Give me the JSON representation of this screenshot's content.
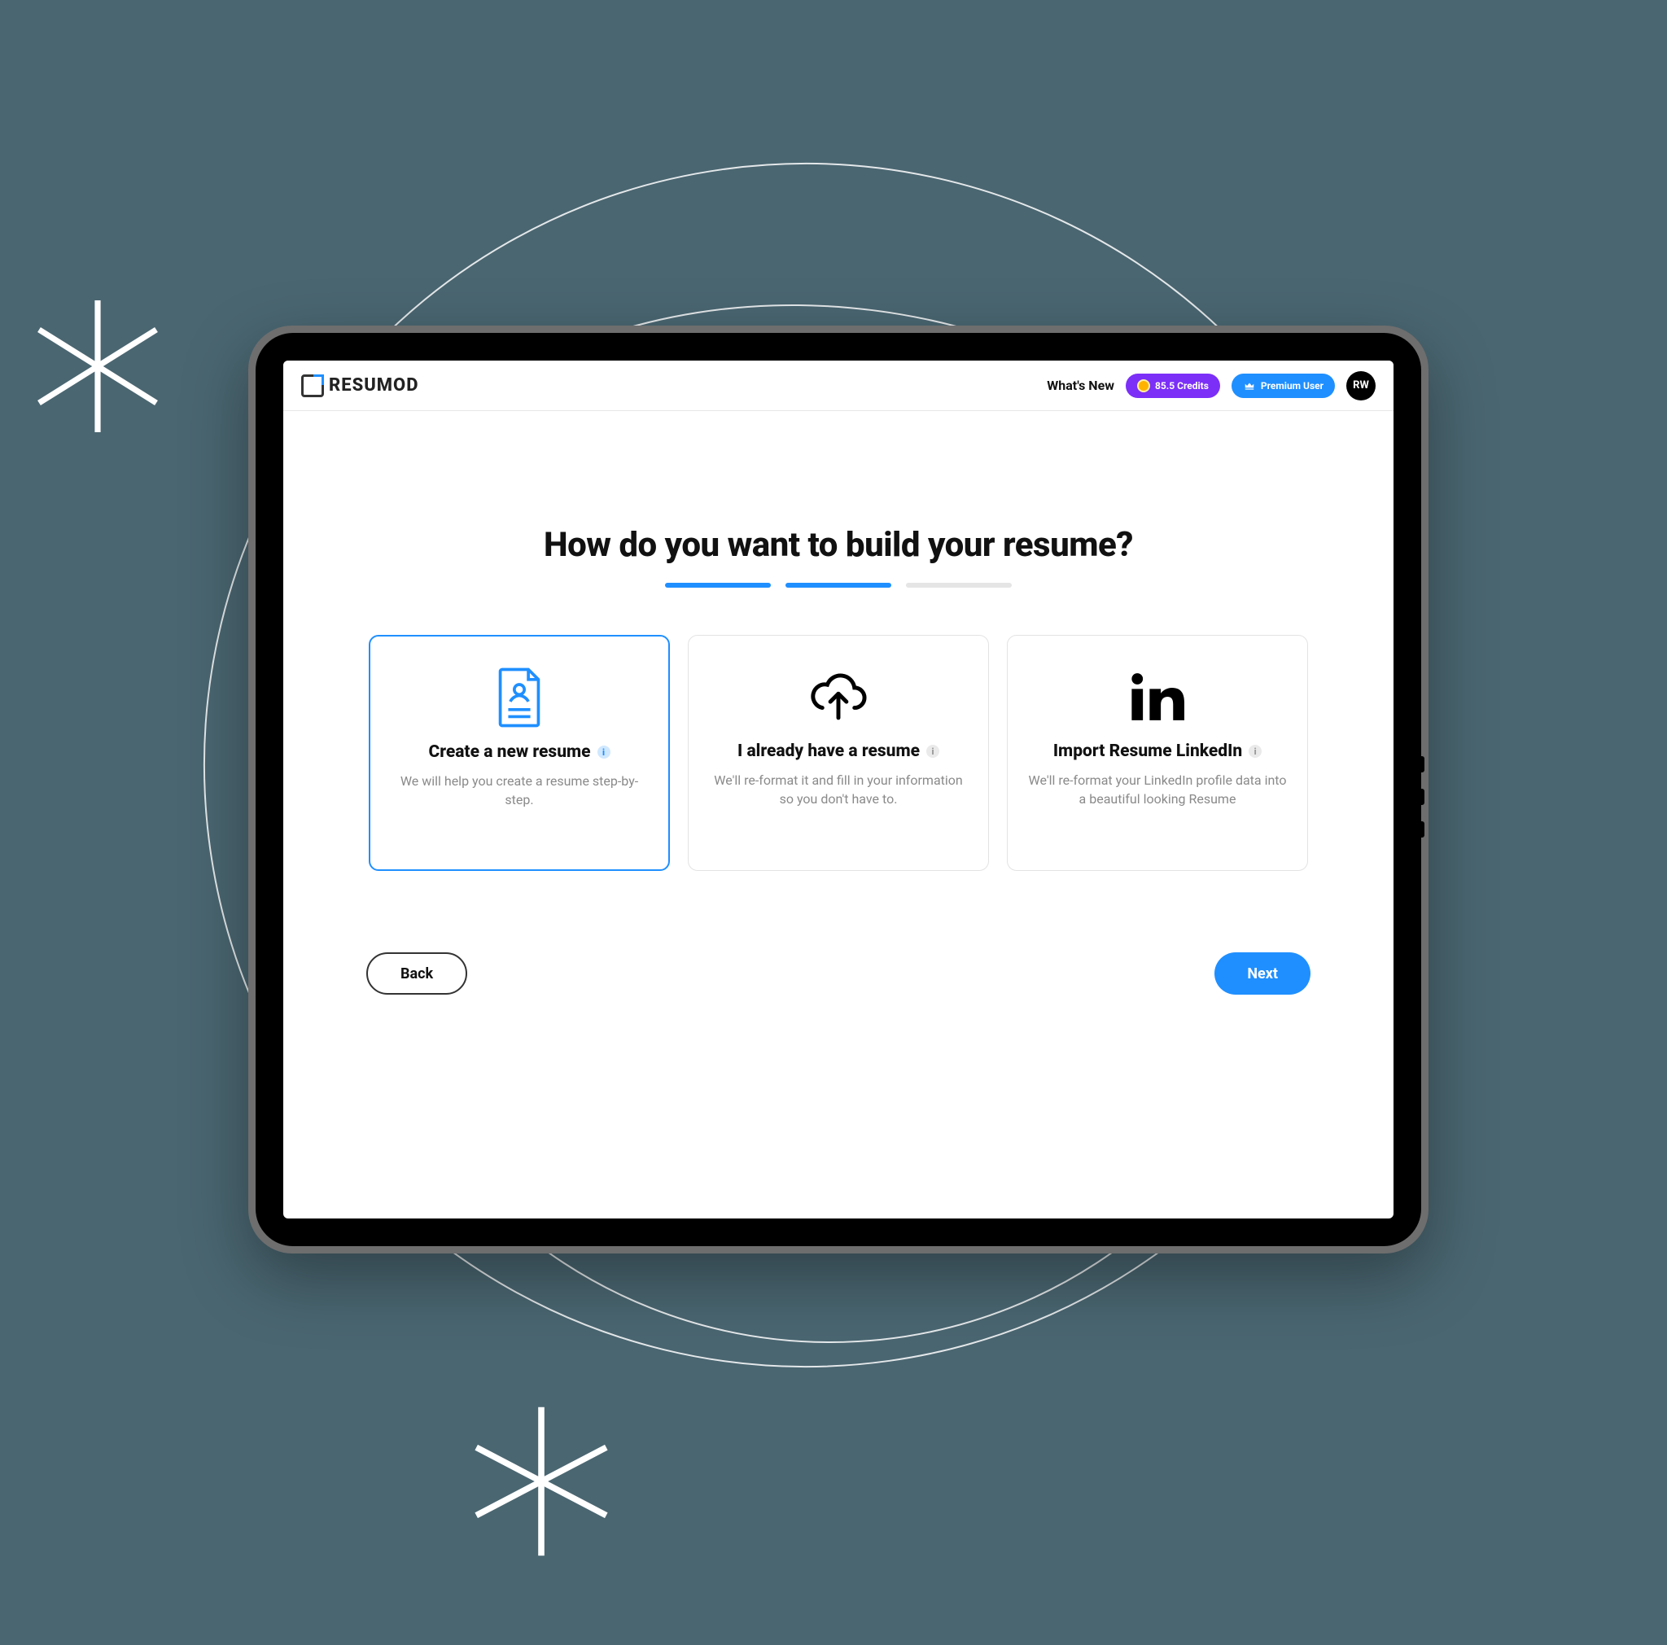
{
  "brand": {
    "name": "RESUMOD"
  },
  "header": {
    "whats_new": "What's New",
    "credits_label": "85.5 Credits",
    "premium_label": "Premium User",
    "avatar_initials": "RW"
  },
  "title": "How do you want to build your resume?",
  "progress": {
    "total": 3,
    "active": 2
  },
  "options": [
    {
      "title": "Create a new resume",
      "desc": "We will help you create a resume step-by-step.",
      "info_style": "blue",
      "selected": true,
      "icon": "resume-doc"
    },
    {
      "title": "I already have a resume",
      "desc": "We'll re-format it and fill in your information so you don't have to.",
      "info_style": "grey",
      "selected": false,
      "icon": "cloud-upload"
    },
    {
      "title": "Import Resume LinkedIn",
      "desc": "We'll re-format your LinkedIn profile data into a beautiful looking Resume",
      "info_style": "grey",
      "selected": false,
      "icon": "linkedin"
    }
  ],
  "buttons": {
    "back": "Back",
    "next": "Next"
  }
}
